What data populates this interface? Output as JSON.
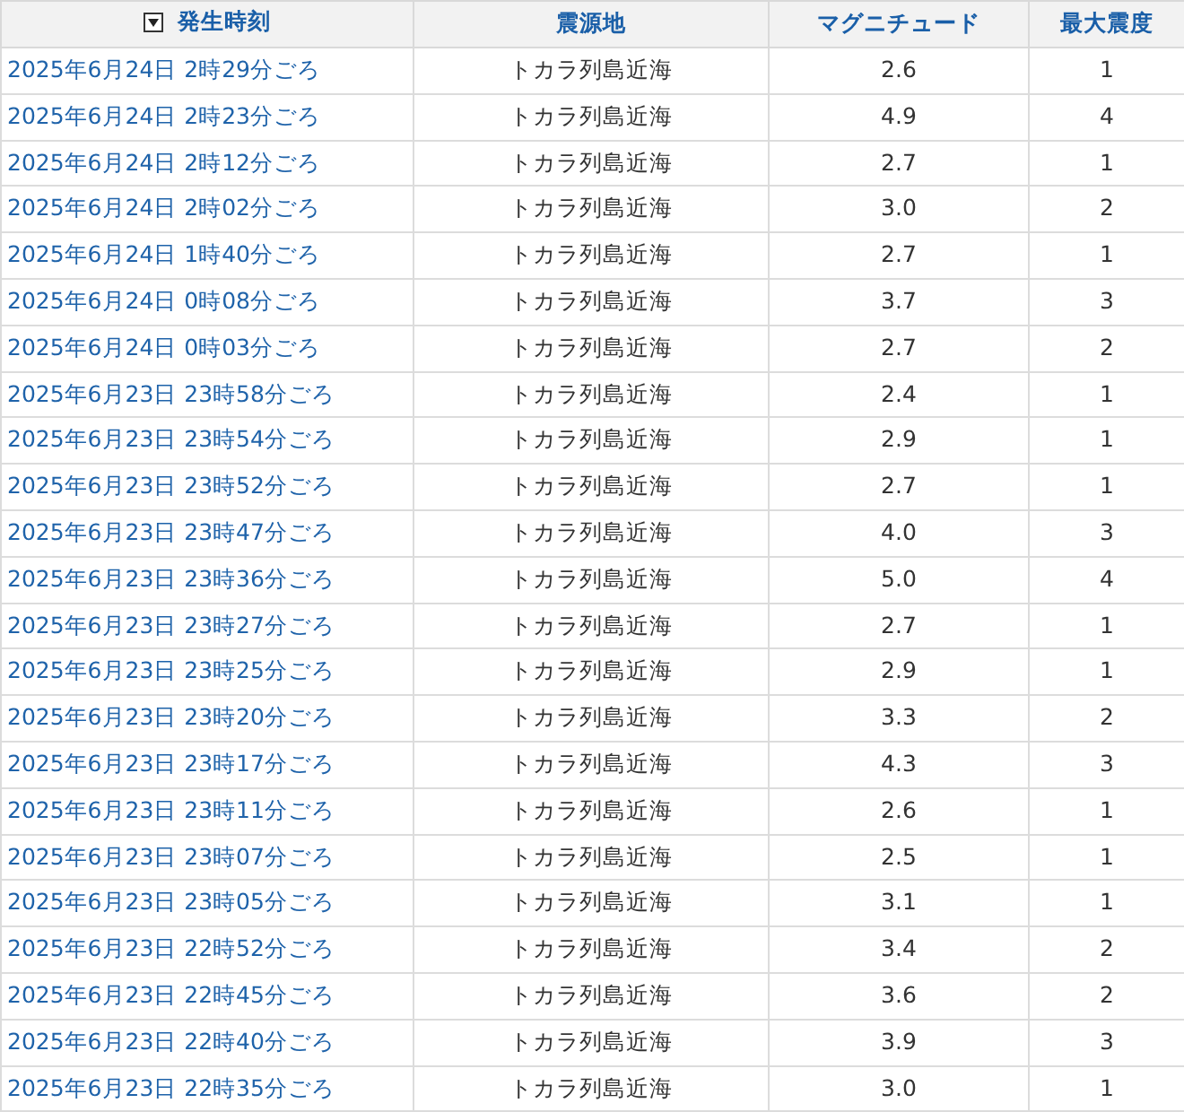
{
  "table": {
    "columns": [
      {
        "label": "発生時刻",
        "sorted": true
      },
      {
        "label": "震源地",
        "sorted": false
      },
      {
        "label": "マグニチュード",
        "sorted": false
      },
      {
        "label": "最大震度",
        "sorted": false
      }
    ],
    "rows": [
      {
        "time": "2025年6月24日 2時29分ごろ",
        "epicenter": "トカラ列島近海",
        "magnitude": "2.6",
        "intensity": "1"
      },
      {
        "time": "2025年6月24日 2時23分ごろ",
        "epicenter": "トカラ列島近海",
        "magnitude": "4.9",
        "intensity": "4"
      },
      {
        "time": "2025年6月24日 2時12分ごろ",
        "epicenter": "トカラ列島近海",
        "magnitude": "2.7",
        "intensity": "1"
      },
      {
        "time": "2025年6月24日 2時02分ごろ",
        "epicenter": "トカラ列島近海",
        "magnitude": "3.0",
        "intensity": "2"
      },
      {
        "time": "2025年6月24日 1時40分ごろ",
        "epicenter": "トカラ列島近海",
        "magnitude": "2.7",
        "intensity": "1"
      },
      {
        "time": "2025年6月24日 0時08分ごろ",
        "epicenter": "トカラ列島近海",
        "magnitude": "3.7",
        "intensity": "3"
      },
      {
        "time": "2025年6月24日 0時03分ごろ",
        "epicenter": "トカラ列島近海",
        "magnitude": "2.7",
        "intensity": "2"
      },
      {
        "time": "2025年6月23日 23時58分ごろ",
        "epicenter": "トカラ列島近海",
        "magnitude": "2.4",
        "intensity": "1"
      },
      {
        "time": "2025年6月23日 23時54分ごろ",
        "epicenter": "トカラ列島近海",
        "magnitude": "2.9",
        "intensity": "1"
      },
      {
        "time": "2025年6月23日 23時52分ごろ",
        "epicenter": "トカラ列島近海",
        "magnitude": "2.7",
        "intensity": "1"
      },
      {
        "time": "2025年6月23日 23時47分ごろ",
        "epicenter": "トカラ列島近海",
        "magnitude": "4.0",
        "intensity": "3"
      },
      {
        "time": "2025年6月23日 23時36分ごろ",
        "epicenter": "トカラ列島近海",
        "magnitude": "5.0",
        "intensity": "4"
      },
      {
        "time": "2025年6月23日 23時27分ごろ",
        "epicenter": "トカラ列島近海",
        "magnitude": "2.7",
        "intensity": "1"
      },
      {
        "time": "2025年6月23日 23時25分ごろ",
        "epicenter": "トカラ列島近海",
        "magnitude": "2.9",
        "intensity": "1"
      },
      {
        "time": "2025年6月23日 23時20分ごろ",
        "epicenter": "トカラ列島近海",
        "magnitude": "3.3",
        "intensity": "2"
      },
      {
        "time": "2025年6月23日 23時17分ごろ",
        "epicenter": "トカラ列島近海",
        "magnitude": "4.3",
        "intensity": "3"
      },
      {
        "time": "2025年6月23日 23時11分ごろ",
        "epicenter": "トカラ列島近海",
        "magnitude": "2.6",
        "intensity": "1"
      },
      {
        "time": "2025年6月23日 23時07分ごろ",
        "epicenter": "トカラ列島近海",
        "magnitude": "2.5",
        "intensity": "1"
      },
      {
        "time": "2025年6月23日 23時05分ごろ",
        "epicenter": "トカラ列島近海",
        "magnitude": "3.1",
        "intensity": "1"
      },
      {
        "time": "2025年6月23日 22時52分ごろ",
        "epicenter": "トカラ列島近海",
        "magnitude": "3.4",
        "intensity": "2"
      },
      {
        "time": "2025年6月23日 22時45分ごろ",
        "epicenter": "トカラ列島近海",
        "magnitude": "3.6",
        "intensity": "2"
      },
      {
        "time": "2025年6月23日 22時40分ごろ",
        "epicenter": "トカラ列島近海",
        "magnitude": "3.9",
        "intensity": "3"
      },
      {
        "time": "2025年6月23日 22時35分ごろ",
        "epicenter": "トカラ列島近海",
        "magnitude": "3.0",
        "intensity": "1"
      }
    ]
  }
}
